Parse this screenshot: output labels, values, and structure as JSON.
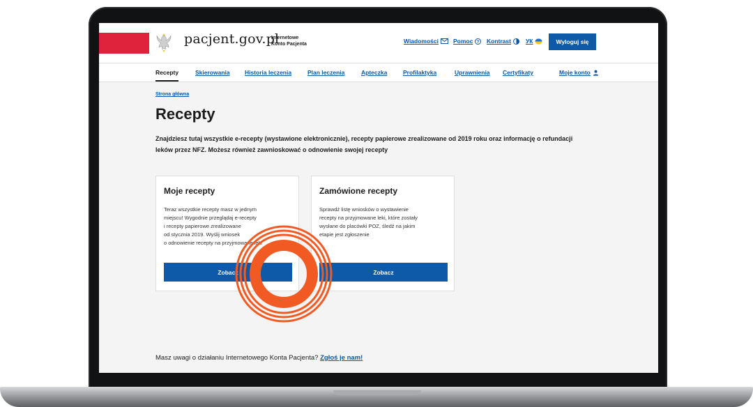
{
  "header": {
    "logo_text": "pacjent.gov.pl",
    "logo_sub_line1": "Internetowe",
    "logo_sub_line2": "Konto Pacjenta",
    "links": {
      "news": "Wiadomości",
      "help": "Pomoc",
      "contrast": "Kontrast",
      "lang": "УК"
    },
    "logout_label": "Wyloguj się",
    "colors": {
      "flag_red": "#e0233c",
      "primary_blue": "#0f5aa8"
    }
  },
  "nav": {
    "items": [
      {
        "label": "Recepty",
        "active": true
      },
      {
        "label": "Skierowania",
        "active": false
      },
      {
        "label": "Historia leczenia",
        "active": false
      },
      {
        "label": "Plan leczenia",
        "active": false
      },
      {
        "label": "Apteczka",
        "active": false
      },
      {
        "label": "Profilaktyka",
        "active": false
      },
      {
        "label": "Uprawnienia",
        "active": false
      },
      {
        "label": "Certyfikaty",
        "active": false
      },
      {
        "label": "Moje konto",
        "active": false
      }
    ]
  },
  "breadcrumb": "Strona główna",
  "page": {
    "title": "Recepty",
    "lead_line1": "Znajdziesz tutaj wszystkie e-recepty (wystawione elektronicznie), recepty papierowe zrealizowane od 2019 roku oraz informację o refundacji",
    "lead_line2": "leków przez NFZ. Możesz również zawnioskować o odnowienie swojej recepty"
  },
  "cards": [
    {
      "title": "Moje recepty",
      "text_lines": [
        "Teraz wszystkie recepty masz w jednym",
        "miejscu! Wygodnie przeglądaj e-recepty",
        "i recepty papierowe zrealizowane",
        "od stycznia 2019. Wyślij wniosek",
        "o odnowienie recepty na przyjmowane leki"
      ],
      "button": "Zobacz"
    },
    {
      "title": "Zamówione recepty",
      "text_lines": [
        "Sprawdź listę wniosków o wystawienie",
        "recepty na przyjmowane leki, które zostały",
        "wysłane do placówki POZ, śledź na jakim",
        "etapie jest zgłoszenie"
      ],
      "button": "Zobacz"
    }
  ],
  "feedback": {
    "text": "Masz uwagi o działaniu Internetowego Konta Pacjenta?",
    "link": "Zgłoś je nam!"
  },
  "overlay": {
    "color": "#f15a22",
    "icon": "click-target-rings"
  }
}
